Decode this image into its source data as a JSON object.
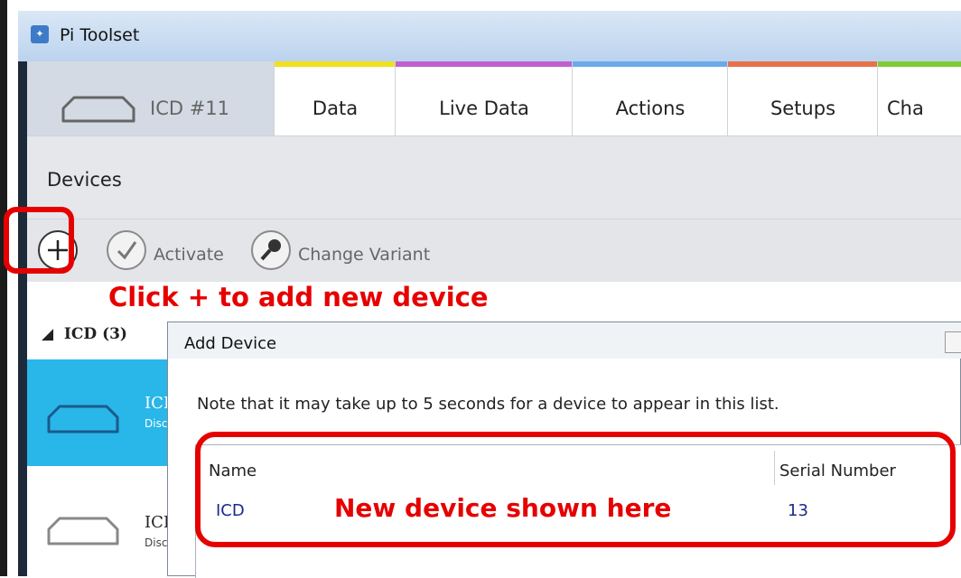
{
  "window": {
    "title": "Pi Toolset"
  },
  "device_tab": {
    "label": "ICD #11"
  },
  "tabs": [
    {
      "label": "Data",
      "color": "#f0e020"
    },
    {
      "label": "Live Data",
      "color": "#c060d0"
    },
    {
      "label": "Actions",
      "color": "#6aaae8"
    },
    {
      "label": "Setups",
      "color": "#e8704a"
    },
    {
      "label": "Cha",
      "color": "#80cc30"
    }
  ],
  "devices_header": {
    "label": "Devices"
  },
  "toolbar": {
    "add_label": "+",
    "activate_label": "Activate",
    "change_variant_label": "Change Variant"
  },
  "annotations": {
    "add_hint": "Click + to add new device",
    "list_hint": "New device shown here"
  },
  "device_list": {
    "group_label": "ICD (3)",
    "rows": [
      {
        "name": "ICD",
        "status": "Disc",
        "selected": true
      },
      {
        "name": "ICD",
        "status": "Disc",
        "selected": false
      }
    ]
  },
  "dialog": {
    "title": "Add Device",
    "note": "Note that it may take up to 5 seconds for a device to appear in this list.",
    "columns": [
      "Name",
      "Serial Number"
    ],
    "rows": [
      {
        "name": "ICD",
        "serial": "13"
      }
    ]
  }
}
